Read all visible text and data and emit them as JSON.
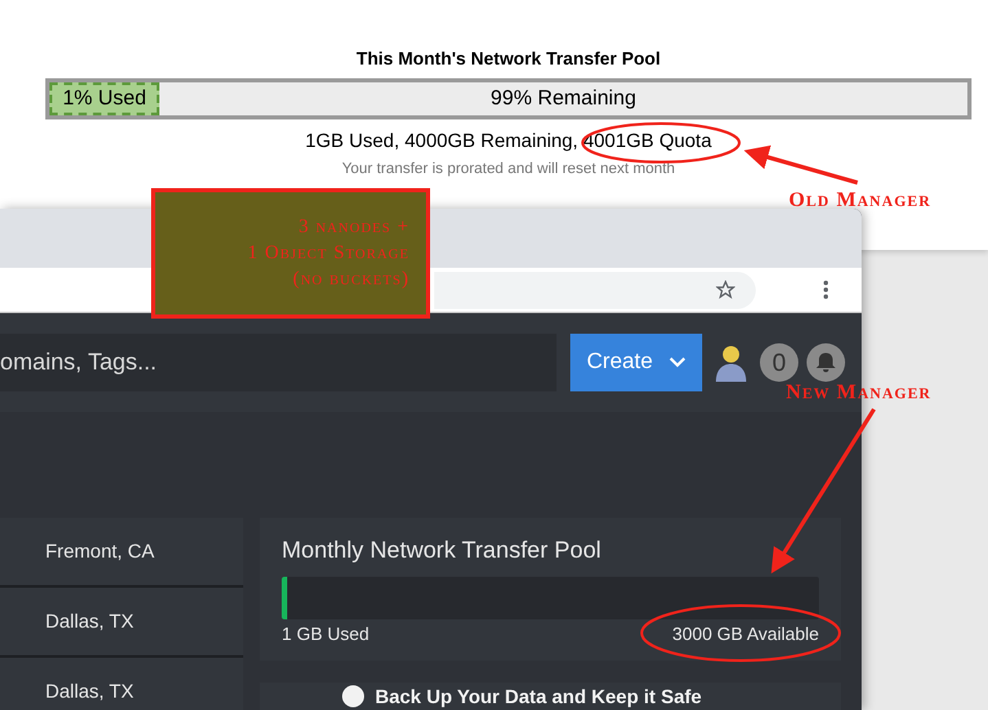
{
  "old_manager": {
    "title": "This Month's Network Transfer Pool",
    "bar": {
      "used_label": "1% Used",
      "remaining_label": "99% Remaining"
    },
    "summary": "1GB Used, 4000GB Remaining, 4001GB Quota",
    "note": "Your transfer is prorated and will reset next month"
  },
  "annotations": {
    "note_box": [
      "3 nanodes +",
      "1 Object Storage",
      "(no buckets)"
    ],
    "old_label": "Old Manager",
    "new_label": "New Manager"
  },
  "app": {
    "search": {
      "value": "omains, Tags..."
    },
    "create_button": "Create",
    "notification_count": "0",
    "locations": [
      "Fremont, CA",
      "Dallas, TX",
      "Dallas, TX"
    ],
    "transfer_card": {
      "title": "Monthly Network Transfer Pool",
      "level": 0.003,
      "used": "1 GB Used",
      "available": "3000 GB Available"
    },
    "backup_card": {
      "title": "Back Up Your Data and Keep it Safe"
    }
  }
}
